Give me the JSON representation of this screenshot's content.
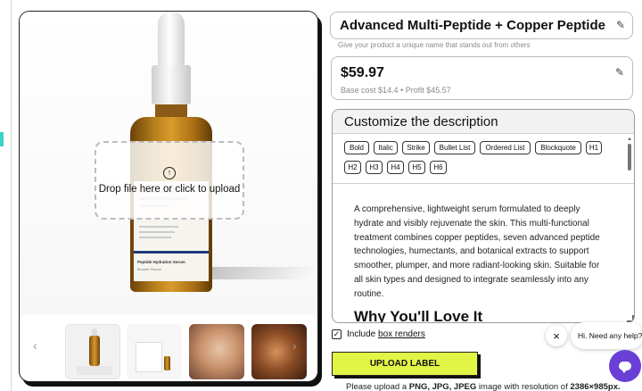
{
  "preview": {
    "dropzone_text": "Drop file here or click to upload",
    "upload_icon_glyph": "↑",
    "product_label": {
      "title": "Peptide Hydration Serum",
      "subtitle": "Booster Flacon"
    },
    "thumbnails": [
      {
        "name": "bottle-front"
      },
      {
        "name": "bottle-with-box"
      },
      {
        "name": "model-face"
      },
      {
        "name": "hand-texture"
      }
    ],
    "prev_glyph": "‹",
    "next_glyph": "›"
  },
  "product": {
    "name": "Advanced Multi-Peptide + Copper Peptide Com",
    "name_help": "Give your product a unique name that stands out from others",
    "price": "$59.97",
    "price_meta": "Base cost $14.4 • Profit $45.57"
  },
  "description": {
    "title": "Customize the description",
    "toolbar": [
      "Bold",
      "Italic",
      "Strike",
      "Bullet List",
      "Ordered List",
      "Blockquote",
      "H1",
      "H2",
      "H3",
      "H4",
      "H5",
      "H6"
    ],
    "body": "A comprehensive, lightweight serum formulated to deeply hydrate and visibly rejuvenate the skin. This multi-functional treatment combines copper peptides, seven advanced peptide technologies, humectants, and botanical extracts to support smoother, plumper, and more radiant-looking skin. Suitable for all skin types and designed to integrate seamlessly into any routine.",
    "next_heading": "Why You'll Love It"
  },
  "options": {
    "checkbox_checked_glyph": "✓",
    "include_label": "Include ",
    "include_link": "box renders"
  },
  "upload": {
    "button_label": "UPLOAD LABEL",
    "help_prefix": "Please upload a ",
    "help_formats": "PNG, JPG, JPEG",
    "help_mid": " image with resolution of ",
    "help_resolution": "2386×985px."
  },
  "chat": {
    "close_glyph": "×",
    "bubble_text": "Hi. Need any help?"
  },
  "colors": {
    "upload_button": "#e1f547",
    "chat_button": "#6a3fd6",
    "left_accent": "#39d3c7"
  }
}
